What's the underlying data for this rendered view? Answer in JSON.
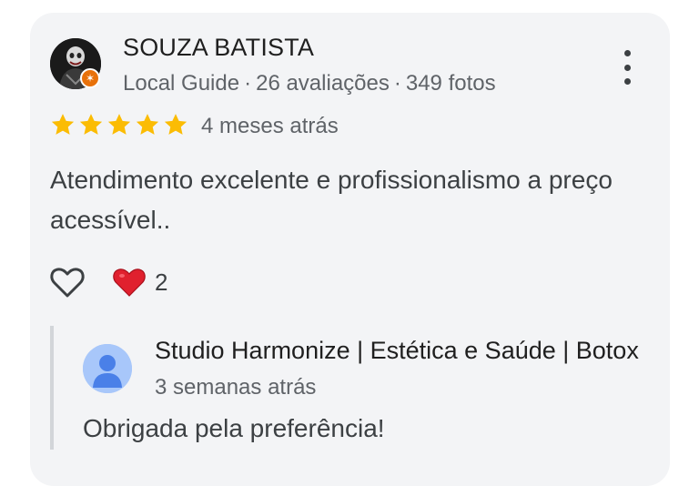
{
  "review": {
    "author_name": "SOUZA BATISTA",
    "author_badge": "Local Guide",
    "reviews_count": "26 avaliações",
    "photos_count": "349 fotos",
    "meta_separator": "·",
    "rating": 5,
    "rating_max": 5,
    "time_ago": "4 meses atrás",
    "text": "Atendimento excelente e profissionalismo a preço acessível..",
    "reaction_count": "2"
  },
  "owner_response": {
    "name": "Studio Harmonize | Estética e Saúde | Botox",
    "time_ago": "3 semanas atrás",
    "text": "Obrigada pela preferência!"
  },
  "icons": {
    "more": "more-vert-icon",
    "like": "heart-outline-icon",
    "reaction": "red-heart-icon",
    "star": "star-icon",
    "owner_avatar": "person-icon"
  },
  "colors": {
    "card_bg": "#f3f4f6",
    "star": "#fbbc04",
    "heart": "#e0202e",
    "guide_badge": "#e8710a",
    "owner_avatar_bg": "#a8c7fa",
    "owner_avatar_fg": "#4a80e8"
  }
}
